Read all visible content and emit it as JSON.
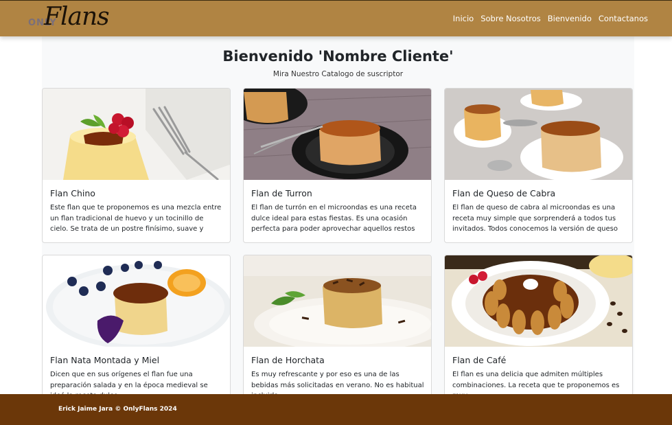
{
  "brand": {
    "prefix": "ONLY",
    "name": "Flans"
  },
  "nav": {
    "items": [
      "Inicio",
      "Sobre Nosotros",
      "Bienvenido",
      "Contactanos"
    ]
  },
  "hero": {
    "title": "Bienvenido 'Nombre Cliente'",
    "subtitle": "Mira Nuestro Catalogo de suscriptor"
  },
  "cards": [
    {
      "title": "Flan Chino",
      "text": "Este flan que te proponemos es una mezcla entre un flan tradicional de huevo y un tocinillo de cielo. Se trata de un postre finísimo, suave y delicado que es...",
      "image": "flan-with-raspberries-icon"
    },
    {
      "title": "Flan de Turron",
      "text": "El flan de turrón en el microondas es una receta dulce ideal para estas fiestas. Es una ocasión perfecta para poder aprovechar aquellos restos que te han...",
      "image": "flan-on-black-plate-icon"
    },
    {
      "title": "Flan de Queso de Cabra",
      "text": "El flan de queso de cabra al microondas es una receta muy simple que sorprenderá a todos tus invitados. Todos conocemos la versión de queso de este postr...",
      "image": "cheese-flan-plates-icon"
    },
    {
      "title": "Flan Nata Montada y Miel",
      "text": "Dicen que en sus orígenes el flan fue una preparación salada y en la época medieval se ideó la receta dulce.",
      "image": "flan-with-berries-cream-icon"
    },
    {
      "title": "Flan de Horchata",
      "text": "Es muy refrescante y por eso es una de las bebidas más solicitadas en verano. No es habitual incluirla",
      "image": "flan-with-chocolate-shavings-icon"
    },
    {
      "title": "Flan de Café",
      "text": "El flan es una delicia que admiten múltiples combinaciones. La receta que te proponemos es muy",
      "image": "coffee-flan-ring-icon"
    }
  ],
  "footer": {
    "text": "Erick Jaime Jara © OnlyFlans 2024"
  },
  "colors": {
    "navbar": "#b08443",
    "footer": "#6b3709",
    "page_bg": "#f8f9fa"
  }
}
